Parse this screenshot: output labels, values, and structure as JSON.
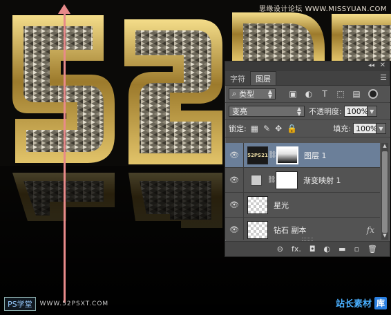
{
  "watermark": {
    "top_right": "思缘设计论坛  WWW.MISSYUAN.COM",
    "bottom_left_badge": "PS学堂",
    "bottom_left_url": "WWW.52PSXT.COM",
    "bottom_right": "站长素材",
    "bottom_right_logo": "库"
  },
  "panel": {
    "collapse_glyph": "◂◂",
    "close_glyph": "✕",
    "tabs": [
      {
        "label": "字符",
        "active": false
      },
      {
        "label": "图层",
        "active": true
      }
    ],
    "menu_glyph": "☰",
    "filter": {
      "search_glyph": "⌕",
      "kind_label": "类型",
      "icons": [
        "image-filter-icon",
        "adjustment-filter-icon",
        "type-filter-icon",
        "shape-filter-icon",
        "smart-object-filter-icon"
      ]
    },
    "blend_mode": "变亮",
    "opacity_label": "不透明度:",
    "opacity_value": "100%",
    "lock_label": "锁定:",
    "fill_label": "填充:",
    "fill_value": "100%",
    "layers": [
      {
        "name": "图层 1",
        "thumb_text": "52PS21",
        "thumb_type": "text",
        "mask": "gradient",
        "selected": true,
        "fx": ""
      },
      {
        "name": "渐变映射 1",
        "thumb_type": "adjustment",
        "mask": "white",
        "selected": false,
        "fx": ""
      },
      {
        "name": "星光",
        "thumb_type": "checker",
        "mask": "",
        "selected": false,
        "fx": ""
      },
      {
        "name": "钻石 副本",
        "thumb_type": "checker",
        "mask": "",
        "selected": false,
        "fx": "fx"
      }
    ],
    "bottom_icons": [
      "link-layers-icon",
      "fx-icon",
      "add-mask-icon",
      "adjustment-layer-icon",
      "new-group-icon",
      "new-layer-icon",
      "delete-layer-icon"
    ],
    "bottom_glyphs": [
      "⊖",
      "fx.",
      "◘",
      "◐",
      "▬",
      "▫",
      "🗑"
    ]
  }
}
